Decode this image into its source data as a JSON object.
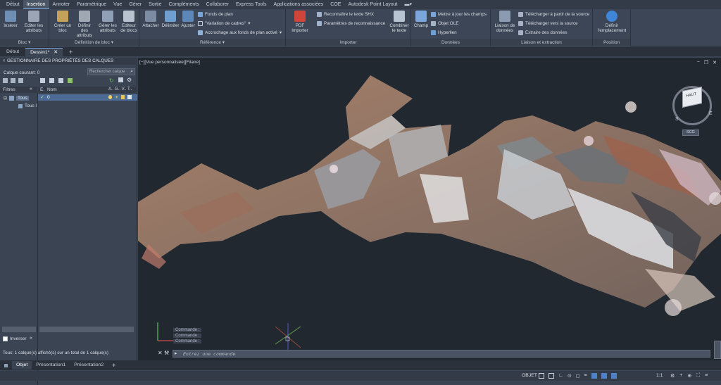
{
  "menu": {
    "items": [
      "Début",
      "Insertion",
      "Annoter",
      "Paramétrique",
      "Vue",
      "Gérer",
      "Sortie",
      "Compléments",
      "Collaborer",
      "Express Tools",
      "Applications associées",
      "COE",
      "Autodesk Point Layout"
    ],
    "active_index": 1
  },
  "ribbon": {
    "bloc": {
      "title": "Bloc",
      "inserer": "Insérer",
      "editer": "Editer les attributs"
    },
    "definition": {
      "title": "Définition de bloc",
      "creer": "Créer un bloc",
      "definir": "Définir des attributs",
      "gerer": "Gérer les attributs",
      "editeur": "Editeur de blocs"
    },
    "reference": {
      "title": "Référence",
      "attacher": "Attacher",
      "delimiter": "Délimiter",
      "ajuster": "Ajuster",
      "fonds": "Fonds de plan",
      "variation": "\"Variation de cadres\"",
      "accrochage": "Accrochage aux fonds de plan activé"
    },
    "importer": {
      "title": "Importer",
      "pdf": "PDF Importer",
      "shx": "Reconnaître le texte SHX",
      "params": "Paramètres de reconnaissance",
      "combiner": "Combiner le texte"
    },
    "donnees": {
      "title": "Données",
      "champ": "Champ",
      "mettre": "Mettre à jour les champs",
      "ole": "Objet OLE",
      "hyperlien": "Hyperlien"
    },
    "liaison": {
      "title": "Liaison et extraction",
      "liaison": "Liaison de données",
      "telecharger1": "Télécharger à partir de la source",
      "telecharger2": "Télécharger vers la source",
      "extraire": "Extraire des données"
    },
    "position": {
      "title": "Position",
      "definir": "Définir l'emplacement"
    }
  },
  "doc_tabs": [
    "Début",
    "Dessin1*"
  ],
  "layers": {
    "title": "GESTIONNAIRE DES PROPRIÉTÉS DES CALQUES",
    "current": "Calque courant: 0",
    "search_placeholder": "Rechercher calque",
    "filters_label": "Filtres",
    "col_e": "E.",
    "col_nom": "Nom",
    "cols_right": "A.. G.. V.. T..",
    "tree_root": "Tous",
    "tree_child": "Tous l",
    "row_name": "0",
    "invert": "Inverser",
    "status": "Tous: 1 calque(s) affiché(s) sur un total de 1 calque(s)"
  },
  "viewport": {
    "label": "[−][Vue personnalisée][Filaire]",
    "viewcube_top": "HAUT",
    "viewcube_s": "S",
    "viewcube_e": "E",
    "wcs": "SCG"
  },
  "command": {
    "history": [
      "Commande :",
      "Commande :",
      "Commande :"
    ],
    "placeholder": "Entrez une commande"
  },
  "layout_tabs": [
    "Objet",
    "Présentation1",
    "Présentation2"
  ],
  "status": {
    "objet": "OBJET",
    "scale": "1:1"
  },
  "colors": {
    "accent": "#7aa6dc",
    "viewport_bg": "#212830"
  }
}
